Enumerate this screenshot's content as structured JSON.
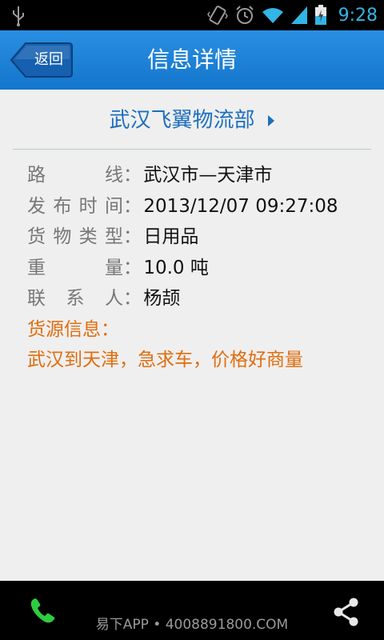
{
  "status_bar": {
    "time": "9:28",
    "icons": [
      "usb-icon",
      "vibrate-icon",
      "alarm-icon",
      "wifi-icon",
      "signal-icon",
      "battery-charging-icon"
    ]
  },
  "header": {
    "back_label": "返回",
    "title": "信息详情"
  },
  "company": {
    "name": "武汉飞翼物流部"
  },
  "details": {
    "route_label": "路 线",
    "route_value": "武汉市—天津市",
    "time_label": "发布时间",
    "time_value": "2013/12/07 09:27:08",
    "type_label": "货物类型",
    "type_value": "日用品",
    "weight_label": "重 量",
    "weight_value": "10.0 吨",
    "contact_label": "联 系 人",
    "contact_value": "杨颉",
    "source_label": "货源信息",
    "source_value": "武汉到天津，急求车，价格好商量",
    "colon": "："
  },
  "footer": {
    "text": "易下APP • 4008891800.COM"
  },
  "colors": {
    "accent": "#1c6fc0",
    "highlight": "#e06d0d",
    "statusbar_icon": "#33b5e5"
  }
}
